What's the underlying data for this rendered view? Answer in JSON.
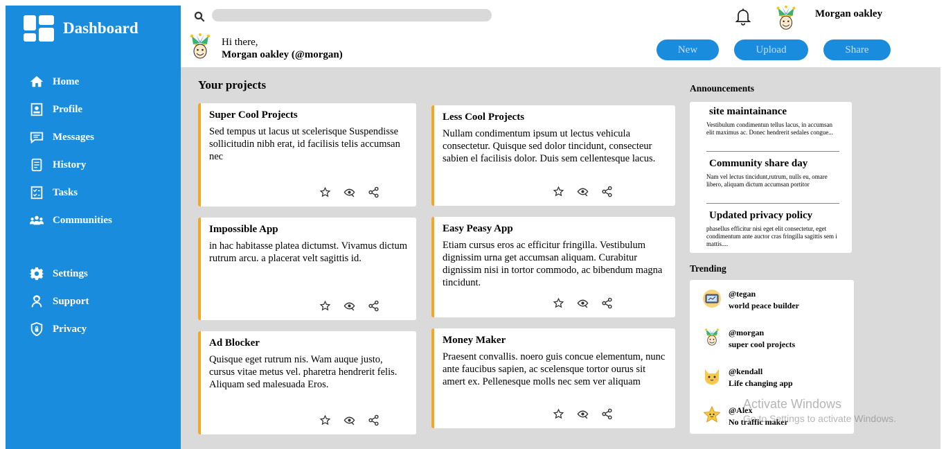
{
  "sidebar": {
    "title": "Dashboard",
    "items": [
      {
        "label": "Home",
        "icon": "home-icon"
      },
      {
        "label": "Profile",
        "icon": "profile-icon"
      },
      {
        "label": "Messages",
        "icon": "messages-icon"
      },
      {
        "label": "History",
        "icon": "history-icon"
      },
      {
        "label": "Tasks",
        "icon": "tasks-icon"
      },
      {
        "label": "Communities",
        "icon": "communities-icon"
      }
    ],
    "bottom_items": [
      {
        "label": "Settings",
        "icon": "gear-icon"
      },
      {
        "label": "Support",
        "icon": "support-icon"
      },
      {
        "label": "Privacy",
        "icon": "shield-icon"
      }
    ]
  },
  "header": {
    "search_placeholder": "",
    "username": "Morgan oakley",
    "greeting": "Hi there,",
    "greeting_name": "Morgan oakley (@morgan)",
    "buttons": {
      "new": "New",
      "upload": "Upload",
      "share": "Share"
    }
  },
  "projects": {
    "title": "Your projects",
    "items": [
      {
        "title": "Super Cool Projects",
        "description": "Sed tempus ut lacus ut scelerisque Suspendisse sollicitudin nibh erat, id facilisis telis accumsan nec"
      },
      {
        "title": "Less Cool Projects",
        "description": "Nullam condimentum ipsum ut lectus vehicula consectetur. Quisque sed dolor tincidunt, consecteur sabien el facilisis dolor. Duis sem cellentesque lacus."
      },
      {
        "title": "Impossible App",
        "description": "in hac habitasse platea dictumst. Vivamus dictum rutrum arcu. a placerat velt sagittis id."
      },
      {
        "title": "Easy Peasy App",
        "description": "Etiam cursus eros ac efficitur fringilla. Vestibulum dignissim urna get accumsan aliquam. Curabitur dignissim nisi in tortor commodo, ac bibendum magna tincidunt."
      },
      {
        "title": "Ad Blocker",
        "description": "Quisque eget rutrum nis. Wam auque justo, cursus vitae metus vel. pharetra hendrerit felis. Aliquam sed malesuada Eros."
      },
      {
        "title": "Money Maker",
        "description": "Praesent convallis. noero guis concue elementum, nunc ante faucibus sapien, ac scelensque tortor ourus sit amert ex. Pellenesque molls nec sem ver aliquam"
      }
    ]
  },
  "announcements": {
    "title": "Announcements",
    "items": [
      {
        "title": "site maintainance",
        "text": "Vestibulum condimentun tellus lacus, in accumsan elit maximus ac. Donec hendrerit sedales congue..."
      },
      {
        "title": "Community share day",
        "text": "Nam vel lectus tincidunt,rutrum, nulls eu, omare libero, aliquam dictum accumsan portitor"
      },
      {
        "title": "Updated privacy policy",
        "text": "phasellus efficitur nisi eget elit consectetur, eget condimentum ante auctor cras fringilla sagittis sem i mattis...."
      }
    ]
  },
  "trending": {
    "title": "Trending",
    "items": [
      {
        "handle": "@tegan",
        "desc": "world peace builder",
        "avatar": "tv-avatar-icon"
      },
      {
        "handle": "@morgan",
        "desc": "super cool projects",
        "avatar": "jester-avatar-icon"
      },
      {
        "handle": "@kendall",
        "desc": "Life changing app",
        "avatar": "cat-avatar-icon"
      },
      {
        "handle": "@Alex",
        "desc": "No traffic maker",
        "avatar": "star-avatar-icon"
      }
    ]
  },
  "watermark": {
    "line1": "Activate Windows",
    "line2": "Go to Settings to activate Windows."
  },
  "colors": {
    "brand": "#1a8cde",
    "accent": "#f5a623",
    "background": "#dadada"
  }
}
